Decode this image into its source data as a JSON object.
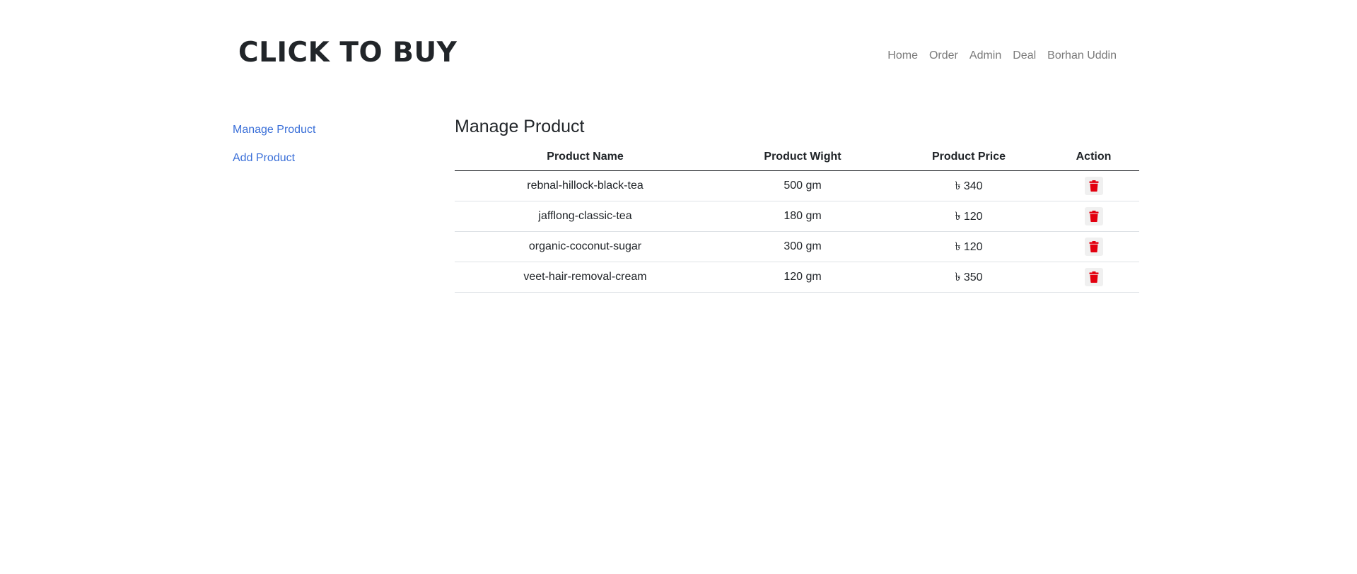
{
  "header": {
    "brand": "CLICK TO BUY",
    "nav": [
      "Home",
      "Order",
      "Admin",
      "Deal",
      "Borhan Uddin"
    ]
  },
  "sidebar": {
    "items": [
      {
        "label": "Manage Product"
      },
      {
        "label": "Add Product"
      }
    ]
  },
  "main": {
    "title": "Manage Product",
    "table": {
      "headers": [
        "Product Name",
        "Product Wight",
        "Product Price",
        "Action"
      ],
      "rows": [
        {
          "name": "rebnal-hillock-black-tea",
          "weight": "500 gm",
          "price": "৳ 340"
        },
        {
          "name": "jafflong-classic-tea",
          "weight": "180 gm",
          "price": "৳ 120"
        },
        {
          "name": "organic-coconut-sugar",
          "weight": "300 gm",
          "price": "৳ 120"
        },
        {
          "name": "veet-hair-removal-cream",
          "weight": "120 gm",
          "price": "৳ 350"
        }
      ]
    }
  },
  "colors": {
    "link": "#3a6fd8",
    "nav": "#7a7a7a",
    "delete_icon": "#e3000f"
  },
  "icons": {
    "delete": "trash-icon"
  }
}
